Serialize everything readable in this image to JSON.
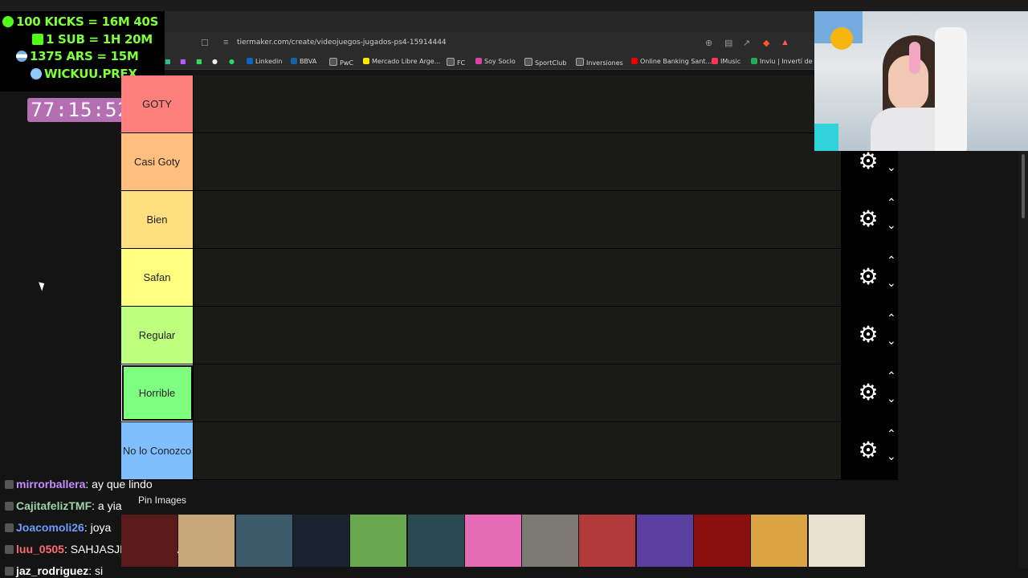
{
  "overlay": {
    "line1": "100 KICKS = 16M 40S",
    "line2": "1 SUB = 1H 20M",
    "line3": "1375 ARS = 15M",
    "line4": "WICKUU.PREX",
    "timer": "77:15:52"
  },
  "browser": {
    "url": "tiermaker.com/create/videojuegos-jugados-ps4-15914444",
    "bookmarks": [
      "Linkedin",
      "BBVA",
      "PwC",
      "Mercado Libre Arge...",
      "FC",
      "Soy Socio",
      "SportClub",
      "Inversiones",
      "Online Banking Sant...",
      "IMusic",
      "Inviu | Invertí de m"
    ]
  },
  "tiers": [
    {
      "label": "GOTY",
      "color": "#ff7f7f"
    },
    {
      "label": "Casi Goty",
      "color": "#ffbf7f"
    },
    {
      "label": "Bien",
      "color": "#ffdf80"
    },
    {
      "label": "Safan",
      "color": "#ffff7f"
    },
    {
      "label": "Regular",
      "color": "#bfff7f"
    },
    {
      "label": "Horrible",
      "color": "#7fff7f"
    },
    {
      "label": "No lo Conozco",
      "color": "#7fbfff"
    }
  ],
  "pin_images": "Pin Images",
  "images": [
    {
      "name": "dark-game-cover",
      "color": "#5a1a1a"
    },
    {
      "name": "bioshock-infinite-cover",
      "color": "#c7a77a"
    },
    {
      "name": "bioshock-remastered-cover",
      "color": "#3d5a6b"
    },
    {
      "name": "injustice-2-cover",
      "color": "#1a2230"
    },
    {
      "name": "minecraft-cover",
      "color": "#6aa84f"
    },
    {
      "name": "bioshock-2-cover",
      "color": "#2a4a52"
    },
    {
      "name": "fall-guys-cover",
      "color": "#e66bb6"
    },
    {
      "name": "metro-last-light-cover",
      "color": "#7a7a72"
    },
    {
      "name": "the-crew-2-cover",
      "color": "#b33a3a"
    },
    {
      "name": "fortnite-cover",
      "color": "#5b3fa0"
    },
    {
      "name": "back-4-blood-cover",
      "color": "#8a1010"
    },
    {
      "name": "naruto-storm-cover",
      "color": "#d9a441"
    },
    {
      "name": "assassins-creed-odyssey-cover",
      "color": "#e8e0d0"
    }
  ],
  "chat": [
    {
      "user": "mirrorballera",
      "text": ": ay que lindo",
      "color": "#c78cff"
    },
    {
      "user": "CajitafelizTMF",
      "text": ": a yia",
      "color": "#9bd4a6"
    },
    {
      "user": "Joacomoli26",
      "text": ": joya",
      "color": "#6c9cff"
    },
    {
      "user": "luu_0505",
      "text": ": SAHJASJHASJHASJAS",
      "color": "#ff6b6b"
    },
    {
      "user": "jaz_rodriguez",
      "text": ": si",
      "color": "#ffffff"
    }
  ]
}
